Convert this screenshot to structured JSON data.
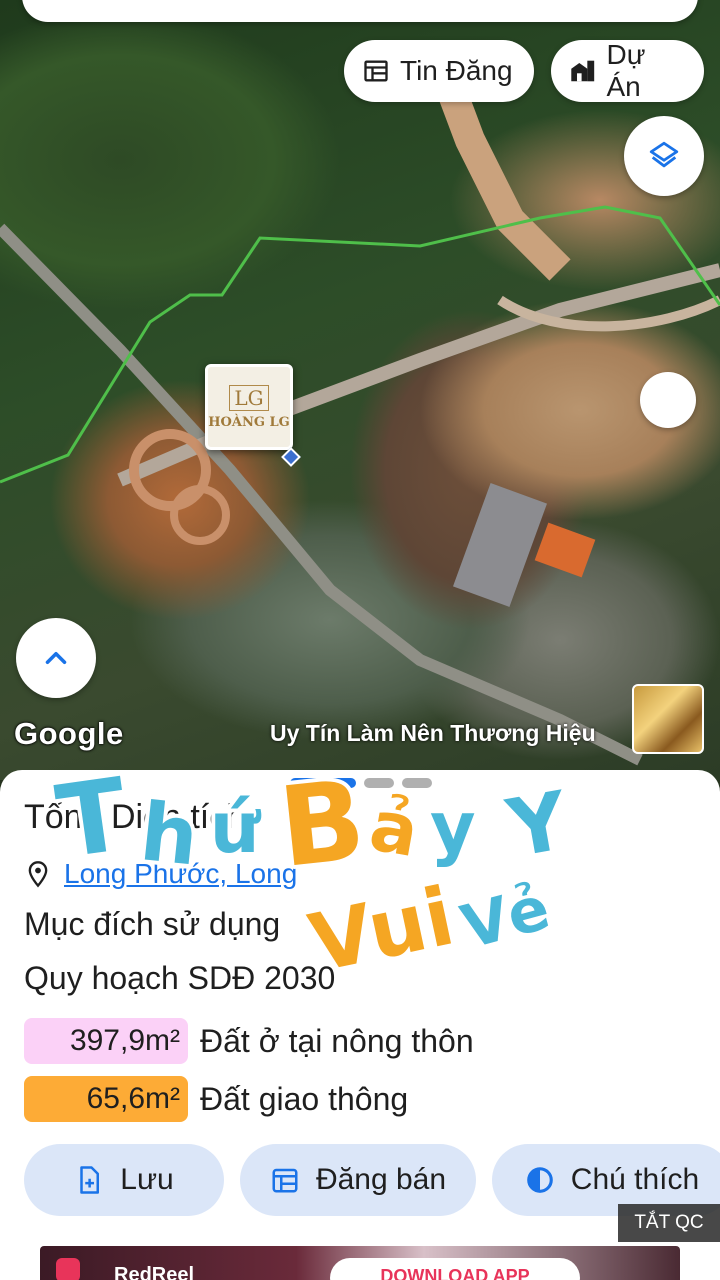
{
  "map": {
    "tin_dang_label": "Tin Đăng",
    "du_an_label": "Dự Án",
    "google_label": "Google",
    "watermark_text": "Uy Tín Làm Nên Thương Hiệu",
    "marker_logo": "LG",
    "marker_name": "HOÀNG LG"
  },
  "sheet": {
    "title": "Tổng Diện tích",
    "location_text": "Long Phước, Long",
    "purpose_text": "Mục đích sử dụng",
    "plan_text": "Quy hoạch SDĐ 2030",
    "land_uses": [
      {
        "area": "397,9m²",
        "label": "Đất ở tại nông thôn",
        "color": "#fbd1f7"
      },
      {
        "area": "65,6m²",
        "label": "Đất giao thông",
        "color": "#fdab36"
      }
    ],
    "actions": {
      "save": "Lưu",
      "post": "Đăng bán",
      "legend": "Chú thích"
    }
  },
  "ads": {
    "close_label": "TẮT QC",
    "app_name": "RedReel",
    "cta": "DOWNLOAD APP"
  },
  "sticker_text": "Thứ Bảy Vui Vẻ",
  "colors": {
    "accent": "#1a73e8",
    "pink_badge": "#fbd1f7",
    "orange_badge": "#fdab36",
    "action_bg": "#dbe6f8"
  }
}
